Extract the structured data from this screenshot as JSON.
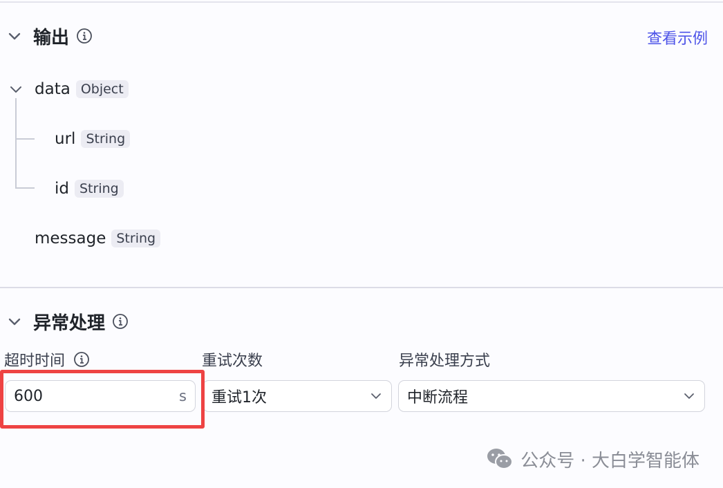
{
  "output": {
    "title": "输出",
    "view_example": "查看示例",
    "fields": [
      {
        "name": "data",
        "type": "Object"
      },
      {
        "name": "url",
        "type": "String"
      },
      {
        "name": "id",
        "type": "String"
      },
      {
        "name": "message",
        "type": "String"
      }
    ]
  },
  "exception": {
    "title": "异常处理",
    "timeout": {
      "label": "超时时间",
      "value": "600",
      "unit": "s"
    },
    "retry": {
      "label": "重试次数",
      "value": "重试1次"
    },
    "mode": {
      "label": "异常处理方式",
      "value": "中断流程"
    }
  },
  "watermark": {
    "text": "公众号 · 大白学智能体"
  },
  "colors": {
    "accent": "#4d53e8",
    "highlight": "#ee4343"
  }
}
